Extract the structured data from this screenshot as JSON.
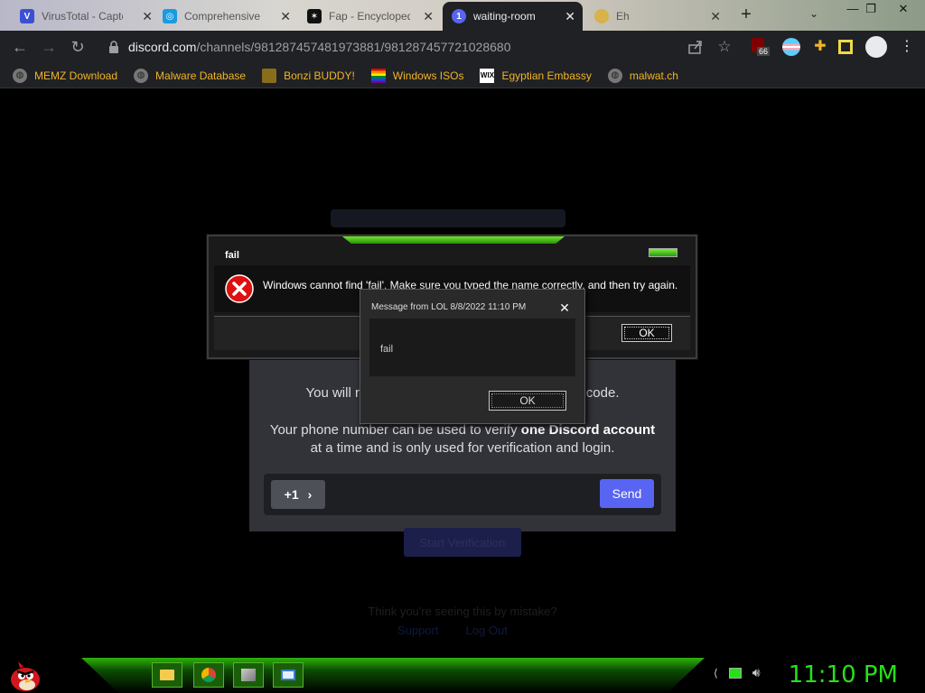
{
  "browser": {
    "tabs": [
      {
        "title": "VirusTotal - Captc",
        "favicon_color": "#3b4fd4",
        "favicon_text": "V"
      },
      {
        "title": "Comprehensive",
        "favicon_color": "#1a9be0",
        "favicon_text": "◎"
      },
      {
        "title": "Fap - Encycloped",
        "favicon_color": "#111111",
        "favicon_text": "✶"
      },
      {
        "title": "waiting-room",
        "favicon_color": "#5865f2",
        "favicon_text": "1"
      },
      {
        "title": "Eh",
        "favicon_color": "#d8b24a",
        "favicon_text": ""
      }
    ],
    "active_tab": 3,
    "url_host": "discord.com",
    "url_path": "/channels/981287457481973881/981287457721028680",
    "extension_badge": "66",
    "bookmarks": [
      {
        "label": "MEMZ Download",
        "icon": "globe-icon"
      },
      {
        "label": "Malware Database",
        "icon": "globe-icon"
      },
      {
        "label": "Bonzi BUDDY!",
        "icon": "bonzi-icon"
      },
      {
        "label": "Windows ISOs",
        "icon": "rainbow-flag-icon"
      },
      {
        "label": "Egyptian Embassy",
        "icon": "wix-icon"
      },
      {
        "label": "malwat.ch",
        "icon": "globe-icon"
      }
    ]
  },
  "discord": {
    "code_line_start": "You will re",
    "code_line_end": "n code.",
    "phone_line_a": "Your phone number can be used to verify ",
    "phone_line_bold": "one Discord account",
    "phone_line_b": " at a time and is only used for verification and login.",
    "country_code": "+1",
    "send_label": "Send",
    "verify_label": "Start Verification",
    "mistake_text": "Think you're seeing this by mistake?",
    "support_label": "Support",
    "logout_label": "Log Out"
  },
  "error_dialog": {
    "title": "fail",
    "message": "Windows cannot find 'fail'. Make sure you typed the name correctly, and then try again.",
    "ok_label": "OK"
  },
  "message_dialog": {
    "title": "Message from LOL 8/8/2022 11:10 PM",
    "text": "fail",
    "ok_label": "OK"
  },
  "taskbar": {
    "clock": "11:10 PM",
    "apps": [
      "folder-icon",
      "chrome-icon",
      "paint-icon",
      "window-icon"
    ]
  },
  "colors": {
    "accent_green": "#27e01b",
    "discord_blurple": "#5865f2",
    "bookmark_text": "#f0b429"
  }
}
